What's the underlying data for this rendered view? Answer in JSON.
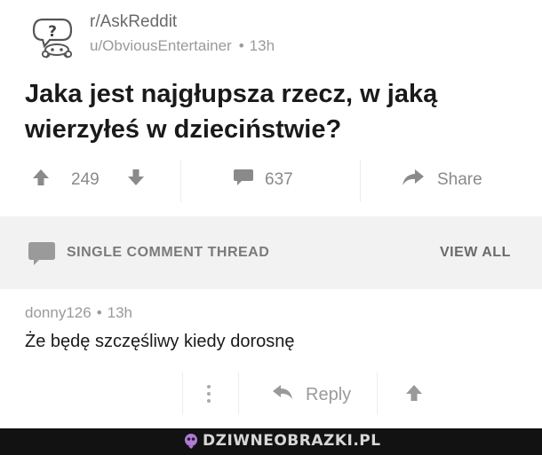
{
  "post": {
    "subreddit": "r/AskReddit",
    "author": "u/ObviousEntertainer",
    "age": "13h",
    "title": "Jaka jest najgłupsza rzecz, w jaką wierzyłeś w dzieciństwie?",
    "upvotes": "249",
    "comments": "637",
    "share_label": "Share"
  },
  "thread": {
    "label": "SINGLE COMMENT THREAD",
    "view_all": "VIEW ALL"
  },
  "comment": {
    "author": "donny126",
    "age": "13h",
    "body": "Że będę szczęśliwy kiedy dorosnę",
    "reply_label": "Reply"
  },
  "footer": {
    "watermark": "DZIWNEOBRAZKI.PL"
  },
  "icons": {
    "avatar": "reddit-alien-question-icon",
    "upvote": "arrow-up-icon",
    "downvote": "arrow-down-icon",
    "comments": "comment-bubble-icon",
    "share": "share-arrow-icon",
    "thread": "comment-bubble-icon",
    "more": "vertical-dots-icon",
    "reply": "reply-arrow-icon",
    "comment_upvote": "arrow-up-icon"
  },
  "colors": {
    "text": "#1a1a1a",
    "muted": "#9a9a9a",
    "bar": "#f2f2f2",
    "footer": "#121212"
  }
}
